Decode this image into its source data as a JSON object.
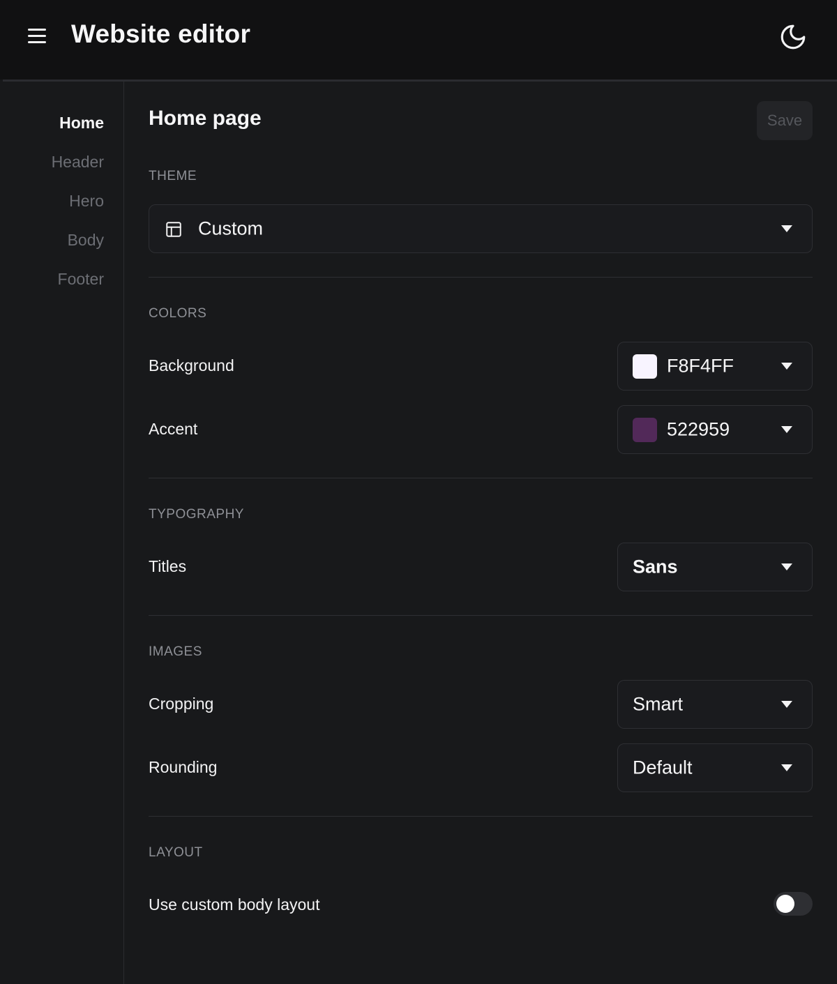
{
  "header": {
    "title": "Website editor",
    "menu_icon": "hamburger-menu-icon",
    "theme_icon": "moon-icon"
  },
  "sidebar": {
    "items": [
      {
        "label": "Home",
        "active": true
      },
      {
        "label": "Header",
        "active": false
      },
      {
        "label": "Hero",
        "active": false
      },
      {
        "label": "Body",
        "active": false
      },
      {
        "label": "Footer",
        "active": false
      }
    ]
  },
  "main": {
    "title": "Home page",
    "save_label": "Save",
    "theme": {
      "section_label": "THEME",
      "value": "Custom",
      "icon": "layout-template-icon"
    },
    "colors": {
      "section_label": "COLORS",
      "background": {
        "label": "Background",
        "value": "F8F4FF",
        "swatch": "#F8F4FF"
      },
      "accent": {
        "label": "Accent",
        "value": "522959",
        "swatch": "#522959"
      }
    },
    "typography": {
      "section_label": "TYPOGRAPHY",
      "titles": {
        "label": "Titles",
        "value": "Sans"
      }
    },
    "images": {
      "section_label": "IMAGES",
      "cropping": {
        "label": "Cropping",
        "value": "Smart"
      },
      "rounding": {
        "label": "Rounding",
        "value": "Default"
      }
    },
    "layout": {
      "section_label": "LAYOUT",
      "custom_body": {
        "label": "Use custom body layout",
        "enabled": false
      }
    }
  }
}
